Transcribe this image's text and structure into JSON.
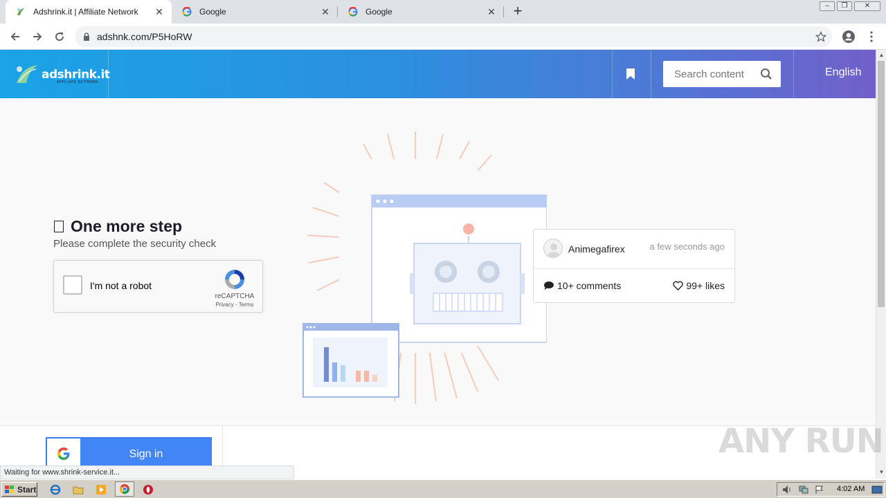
{
  "browser": {
    "tabs": [
      {
        "title": "Adshrink.it | Affiliate Network",
        "active": true
      },
      {
        "title": "Google",
        "active": false
      },
      {
        "title": "Google",
        "active": false
      }
    ],
    "url": "adshnk.com/P5HoRW",
    "status_text": "Waiting for www.shrink-service.it..."
  },
  "header": {
    "logo_text": "adshrink.it",
    "logo_sub": "AFFILIATE NETWORK",
    "search_placeholder": "Search content",
    "language": "English",
    "colors": {
      "gradient_start": "#1aa3e6",
      "gradient_end": "#7160c9"
    }
  },
  "main": {
    "title": "One more step",
    "subtitle": "Please complete the security check",
    "recaptcha": {
      "label": "I'm not a robot",
      "brand": "reCAPTCHA",
      "links": "Privacy - Terms"
    },
    "card": {
      "user": "Animegafirex",
      "time": "a few seconds ago",
      "comments": "10+ comments",
      "likes": "99+ likes"
    },
    "signin_label": "Sign in",
    "signin_icon": "G"
  },
  "watermark": "ANY RUN",
  "taskbar": {
    "start_label": "Start",
    "clock": "4:02 AM"
  }
}
